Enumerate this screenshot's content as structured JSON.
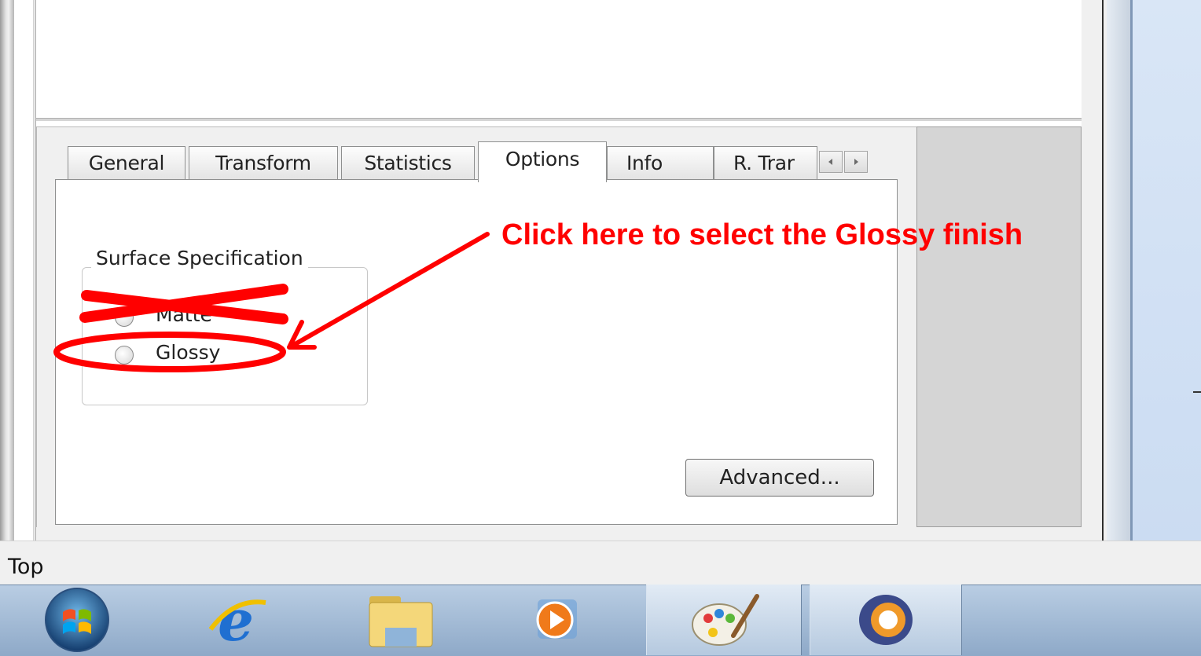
{
  "tabs": [
    {
      "label": "General",
      "active": false
    },
    {
      "label": "Transform",
      "active": false
    },
    {
      "label": "Statistics",
      "active": false
    },
    {
      "label": "Options",
      "active": true
    },
    {
      "label": "Info",
      "active": false
    },
    {
      "label": "R. Trar",
      "active": false
    }
  ],
  "tab_scroll": {
    "left_icon": "chevron-left-icon",
    "right_icon": "chevron-right-icon"
  },
  "surface_spec": {
    "title": "Surface Specification",
    "options": [
      {
        "label": "Matte",
        "selected": false
      },
      {
        "label": "Glossy",
        "selected": false
      }
    ]
  },
  "advanced_button": "Advanced...",
  "annotation": {
    "text": "Click here to select the Glossy finish",
    "color": "#ff0000"
  },
  "status_bar": {
    "text": "Top"
  },
  "taskbar": {
    "items": [
      {
        "name": "windows-start-icon"
      },
      {
        "name": "internet-explorer-icon"
      },
      {
        "name": "file-explorer-icon"
      },
      {
        "name": "media-player-icon"
      },
      {
        "name": "paint-palette-icon"
      },
      {
        "name": "app-ring-icon"
      }
    ]
  }
}
